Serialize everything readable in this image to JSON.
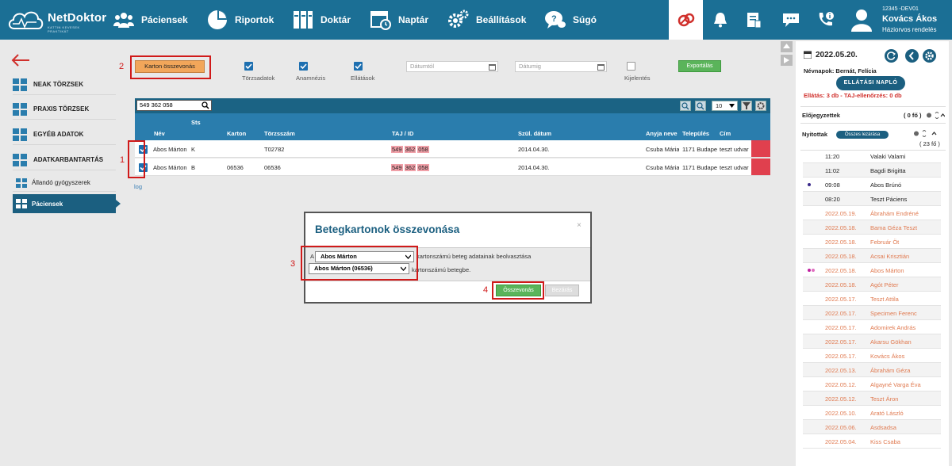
{
  "app": {
    "logo_name": "NetDoktor",
    "logo_sub": "KATTIN KEVESEK PRAKTIKÁT"
  },
  "nav": [
    {
      "label": "Páciensek",
      "icon": "patients-icon"
    },
    {
      "label": "Riportok",
      "icon": "pie-chart-icon"
    },
    {
      "label": "Doktár",
      "icon": "binders-icon"
    },
    {
      "label": "Naptár",
      "icon": "calendar-clock-icon"
    },
    {
      "label": "Beállítások",
      "icon": "gears-icon"
    },
    {
      "label": "Súgó",
      "icon": "help-chat-icon"
    }
  ],
  "user": {
    "id": "12345 -DEV01",
    "name": "Kovács Ákos",
    "role": "Háziorvos rendelés"
  },
  "sidebar": {
    "items": [
      {
        "label": "NEAK TÖRZSEK"
      },
      {
        "label": "PRAXIS TÖRZSEK"
      },
      {
        "label": "EGYÉB ADATOK"
      },
      {
        "label": "ADATKARBANTARTÁS"
      }
    ],
    "sub_items": [
      {
        "label": "Állandó gyógyszerek"
      },
      {
        "label": "Páciensek"
      }
    ]
  },
  "toolbar": {
    "merge_label": "Karton összevonás",
    "checks": [
      {
        "label": "Törzsadatok",
        "checked": true
      },
      {
        "label": "Anamnézis",
        "checked": true
      },
      {
        "label": "Ellátások",
        "checked": true
      }
    ],
    "date_from_placeholder": "Dátumtól",
    "date_to_placeholder": "Dátumig",
    "kijelentes_label": "Kijelentés",
    "export_label": "Exportálás"
  },
  "table": {
    "search_value": "549 362 058",
    "page_size": "10",
    "columns": [
      "Név",
      "Sts",
      "Karton",
      "Törzsszám",
      "TAJ / ID",
      "Szül. dátum",
      "Anyja neve",
      "Település",
      "Cím"
    ],
    "rows": [
      {
        "checked": true,
        "name": "Abos Márton",
        "sts": "K",
        "karton": "",
        "torzsszam": "T02782",
        "taj": [
          "549",
          "362",
          "058"
        ],
        "szul": "2014.04.30.",
        "anyja": "Csuba Mária",
        "telepules": "1171 Budapest",
        "cim": "teszt udvar"
      },
      {
        "checked": true,
        "name": "Abos Márton",
        "sts": "B",
        "karton": "06536",
        "torzsszam": "06536",
        "taj": [
          "549",
          "362",
          "058"
        ],
        "szul": "2014.04.30.",
        "anyja": "Csuba Mária",
        "telepules": "1171 Budapest",
        "cim": "teszt udvar"
      }
    ],
    "log_label": "log"
  },
  "annotations": [
    "1",
    "2",
    "3",
    "4"
  ],
  "modal": {
    "title": "Betegkartonok összevonása",
    "close": "×",
    "prefix": "A",
    "select1": "Abos Márton",
    "text1": "kartonszámú beteg adatainak beolvasztása",
    "select2": "Abos Márton (06536)",
    "text2": "kartonszámú betegbe.",
    "ok_label": "Összevonás",
    "cancel_label": "Bezárás"
  },
  "right_panel": {
    "date": "2022.05.20.",
    "nevnapok": "Névnapok: Bernát, Felícia",
    "naplo_label": "ELLÁTÁSI NAPLÓ",
    "warn": "Ellátás: 3 db - TAJ-ellenőrzés: 0 db",
    "elojegyzettek_label": "Előjegyzettek",
    "elojegyzettek_count": "( 0 fő )",
    "nyitottak_label": "Nyitottak",
    "close_all_label": "Összes lezárása",
    "nyitottak_count": "( 23 fő )",
    "patients": [
      {
        "time": "11:20",
        "name": "Valaki Valami",
        "old": false,
        "dot": ""
      },
      {
        "time": "11:02",
        "name": "Bagdi Brigitta",
        "old": false,
        "dot": ""
      },
      {
        "time": "09:08",
        "name": "Abos Brúnó",
        "old": false,
        "dot": "#3a2a8a"
      },
      {
        "time": "08:20",
        "name": "Teszt Páciens",
        "old": false,
        "dot": ""
      },
      {
        "time": "2022.05.19.",
        "name": "Ábrahám Endréné",
        "old": true,
        "dot": ""
      },
      {
        "time": "2022.05.18.",
        "name": "Bama Géza Teszt",
        "old": true,
        "dot": ""
      },
      {
        "time": "2022.05.18.",
        "name": "Február Öt",
        "old": true,
        "dot": ""
      },
      {
        "time": "2022.05.18.",
        "name": "Acsai Krisztián",
        "old": true,
        "dot": ""
      },
      {
        "time": "2022.05.18.",
        "name": "Abos Márton",
        "old": true,
        "dot": "#c020a0"
      },
      {
        "time": "2022.05.18.",
        "name": "Agót Péter",
        "old": true,
        "dot": ""
      },
      {
        "time": "2022.05.17.",
        "name": "Teszt Attila",
        "old": true,
        "dot": ""
      },
      {
        "time": "2022.05.17.",
        "name": "Specimen Ferenc",
        "old": true,
        "dot": ""
      },
      {
        "time": "2022.05.17.",
        "name": "Adomirek András",
        "old": true,
        "dot": ""
      },
      {
        "time": "2022.05.17.",
        "name": "Akarsu Gökhan",
        "old": true,
        "dot": ""
      },
      {
        "time": "2022.05.17.",
        "name": "Kovács Ákos",
        "old": true,
        "dot": ""
      },
      {
        "time": "2022.05.13.",
        "name": "Ábrahám Géza",
        "old": true,
        "dot": ""
      },
      {
        "time": "2022.05.12.",
        "name": "Algayné Varga Éva",
        "old": true,
        "dot": ""
      },
      {
        "time": "2022.05.12.",
        "name": "Teszt Áron",
        "old": true,
        "dot": ""
      },
      {
        "time": "2022.05.10.",
        "name": "Arató László",
        "old": true,
        "dot": ""
      },
      {
        "time": "2022.05.06.",
        "name": "Asdsadsa",
        "old": true,
        "dot": ""
      },
      {
        "time": "2022.05.04.",
        "name": "Kiss Csaba",
        "old": true,
        "dot": ""
      }
    ]
  },
  "colors": {
    "primary": "#1b6f95",
    "dark": "#1b5f80",
    "header": "#2a7dad",
    "annotation": "#d01a1a",
    "merge_btn": "#f2a65a",
    "green": "#5ab45a",
    "old_entry": "#e07a50"
  }
}
